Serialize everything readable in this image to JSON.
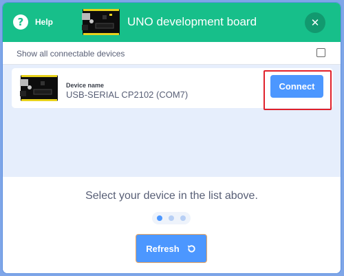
{
  "header": {
    "help_label": "Help",
    "help_glyph": "?",
    "title": "UNO development board",
    "close_glyph": "✕",
    "color": "#17bf8a"
  },
  "options": {
    "show_all_label": "Show all connectable devices",
    "show_all_checked": false
  },
  "devices": [
    {
      "caption": "Device name",
      "name": "USB-SERIAL CP2102 (COM7)",
      "connect_label": "Connect",
      "highlighted": true
    }
  ],
  "footer": {
    "instruction": "Select your device in the list above.",
    "step_count": 3,
    "active_step": 1,
    "refresh_label": "Refresh"
  },
  "colors": {
    "accent": "#4c97ff",
    "highlight": "#e0202a",
    "list_bg": "#e6eefc"
  }
}
